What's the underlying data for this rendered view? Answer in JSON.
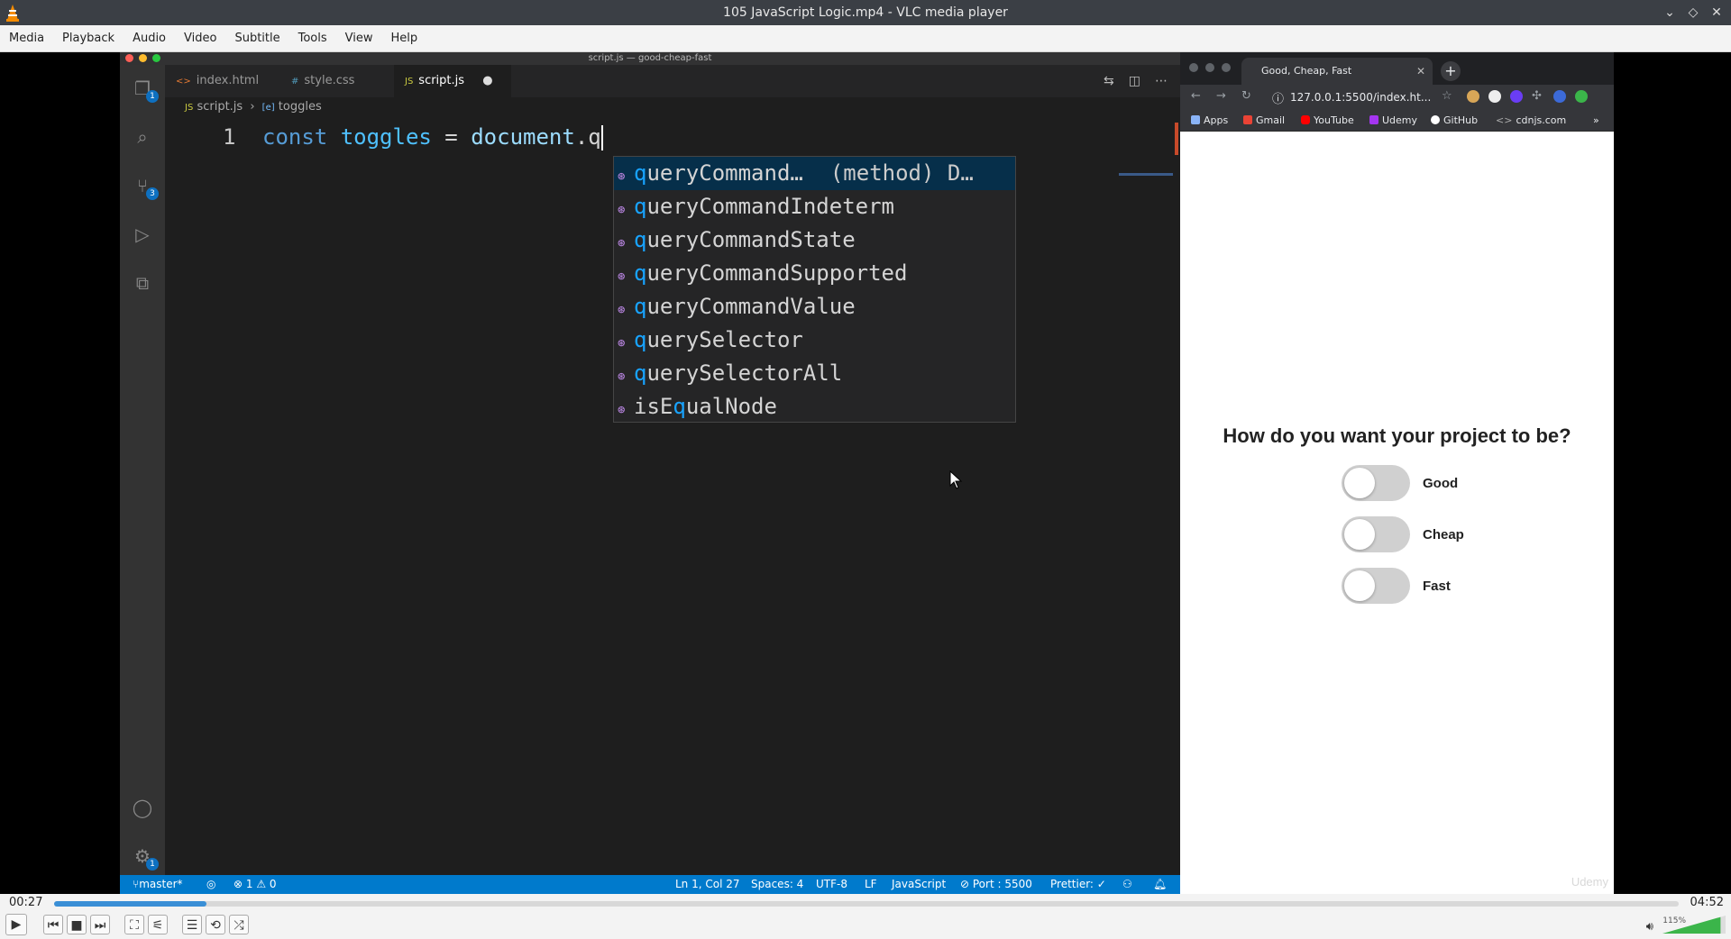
{
  "vlc": {
    "title": "105 JavaScript Logic.mp4 - VLC media player",
    "menu": [
      "Media",
      "Playback",
      "Audio",
      "Video",
      "Subtitle",
      "Tools",
      "View",
      "Help"
    ],
    "time_elapsed": "00:27",
    "time_total": "04:52",
    "progress": 0.094,
    "volume_label": "115%",
    "volume": 1.15
  },
  "vscode": {
    "window_title": "script.js — good-cheap-fast",
    "tabs": [
      {
        "label": "index.html",
        "icon": "<>"
      },
      {
        "label": "style.css",
        "icon": "#"
      },
      {
        "label": "script.js",
        "icon": "JS"
      }
    ],
    "breadcrumb": {
      "file": "script.js",
      "symbol": "toggles"
    },
    "activity_badges": {
      "explorer": "1",
      "source_control": "3",
      "settings": "1"
    },
    "line_number": "1",
    "code": {
      "kw": "const",
      "var": "toggles",
      "op": " = ",
      "obj": "document",
      "rest": ".q"
    },
    "suggestions": [
      {
        "match": "q",
        "rest": "ueryCommand…",
        "detail": "(method) D…"
      },
      {
        "match": "q",
        "rest": "ueryCommandIndeterm",
        "detail": ""
      },
      {
        "match": "q",
        "rest": "ueryCommandState",
        "detail": ""
      },
      {
        "match": "q",
        "rest": "ueryCommandSupported",
        "detail": ""
      },
      {
        "match": "q",
        "rest": "ueryCommandValue",
        "detail": ""
      },
      {
        "match": "q",
        "rest": "uerySelector",
        "detail": ""
      },
      {
        "match": "q",
        "rest": "uerySelectorAll",
        "detail": ""
      },
      {
        "pre": "isE",
        "match": "q",
        "rest": "ualNode",
        "detail": ""
      }
    ],
    "status": {
      "branch": "master*",
      "problems": "⊗ 1 ⚠ 0",
      "position": "Ln 1, Col 27",
      "spaces": "Spaces: 4",
      "encoding": "UTF-8",
      "eol": "LF",
      "language": "JavaScript",
      "port": "⊘ Port : 5500",
      "prettier": "Prettier: ✓"
    }
  },
  "browser": {
    "tab_title": "Good, Cheap, Fast",
    "url": "127.0.0.1:5500/index.ht...",
    "bookmarks": [
      "Apps",
      "Gmail",
      "YouTube",
      "Udemy",
      "GitHub",
      "cdnjs.com"
    ],
    "heading": "How do you want your project to be?",
    "toggles": [
      "Good",
      "Cheap",
      "Fast"
    ],
    "watermark": "Udemy"
  },
  "colors": {
    "vscode_status": "#007acc",
    "accent_blue": "#18a3ff",
    "vlc_progress": "#3a8fd6"
  }
}
